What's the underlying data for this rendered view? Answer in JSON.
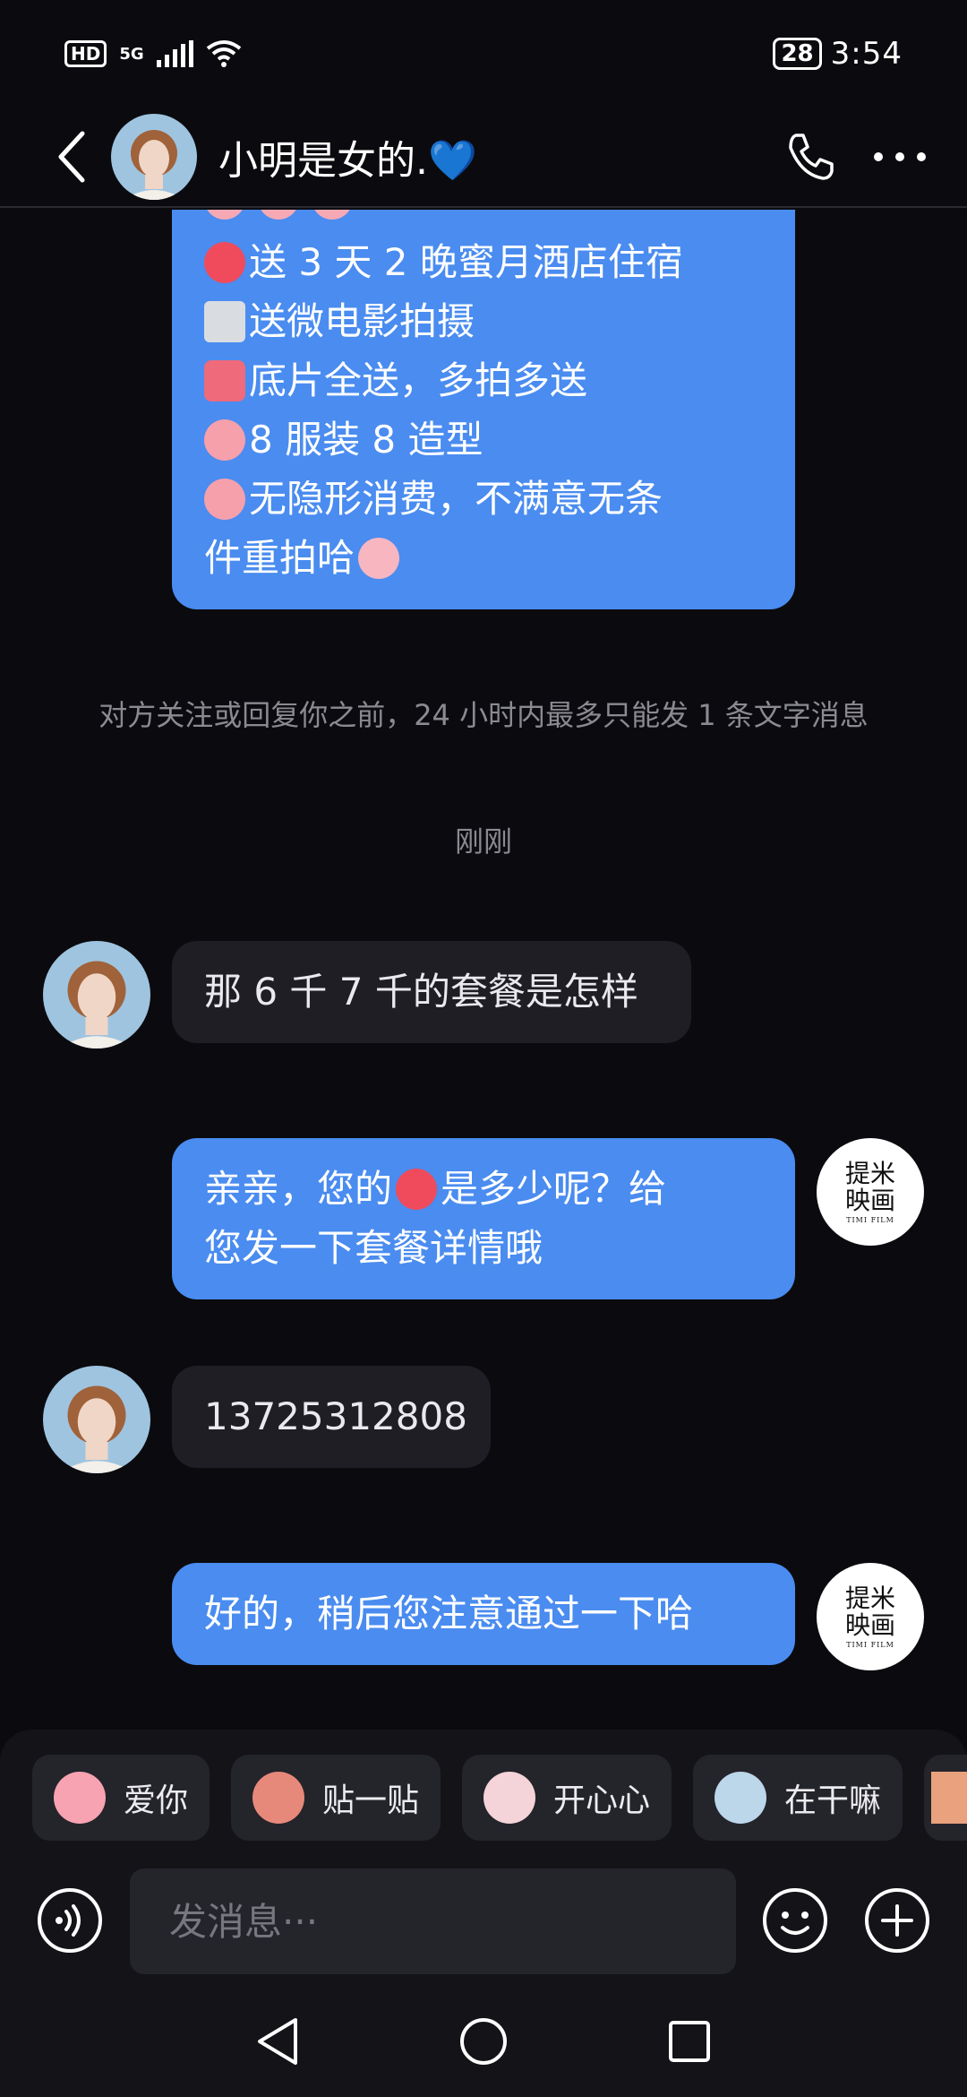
{
  "status": {
    "hd": "HD",
    "network": "5G",
    "battery": "28",
    "time": "3:54"
  },
  "header": {
    "title": "小明是女的.💙"
  },
  "messages": {
    "promo_lines": [
      "送 3 天 2 晚蜜月酒店住宿",
      "送微电影拍摄",
      "底片全送，多拍多送",
      "8 服装 8 造型",
      "无隐形消费，不满意无条",
      "件重拍哈"
    ],
    "notice": "对方关注或回复你之前，24 小时内最多只能发 1 条文字消息",
    "timestamp": "刚刚",
    "msg1": "那 6 千 7 千的套餐是怎样",
    "msg2_part1": "亲亲，您的",
    "msg2_part2": "是多少呢？给",
    "msg2_line2": "您发一下套餐详情哦",
    "msg3": "13725312808",
    "msg4": "好的，稍后您注意通过一下哈"
  },
  "shop_avatar": {
    "line1": "提米",
    "line2": "映画",
    "line3": "TIMI FILM"
  },
  "quick_replies": [
    "爱你",
    "贴一贴",
    "开心心",
    "在干嘛"
  ],
  "input": {
    "placeholder": "发消息···"
  },
  "colors": {
    "bubble_self": "#4a8cf0",
    "bubble_other": "#1e1e24",
    "background": "#0b0b0f"
  }
}
